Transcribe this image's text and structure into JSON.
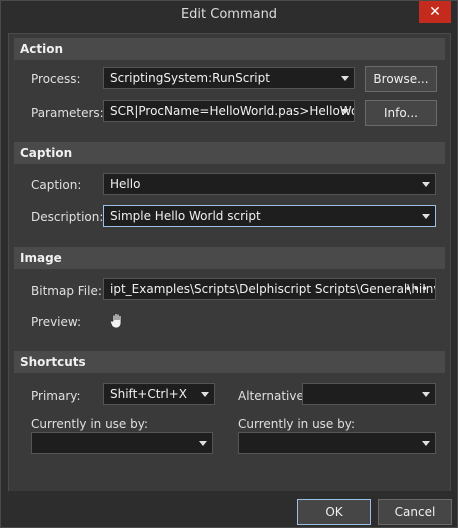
{
  "window": {
    "title": "Edit Command",
    "close": "✕"
  },
  "action": {
    "header": "Action",
    "process_label": "Process:",
    "process_value": "ScriptingSystem:RunScript",
    "browse": "Browse...",
    "parameters_label": "Parameters:",
    "parameters_value": "SCR|ProcName=HelloWorld.pas>HelloWorld",
    "info": "Info..."
  },
  "caption": {
    "header": "Caption",
    "caption_label": "Caption:",
    "caption_value": "Hello",
    "description_label": "Description:",
    "description_value": "Simple Hello World script"
  },
  "image": {
    "header": "Image",
    "bitmap_label": "Bitmap File:",
    "bitmap_value": "ipt_Examples\\Scripts\\Delphiscript Scripts\\General\\hiInv.png",
    "bitmap_more": "•••",
    "preview_label": "Preview:"
  },
  "shortcuts": {
    "header": "Shortcuts",
    "primary_label": "Primary:",
    "primary_value": "Shift+Ctrl+X",
    "alternative_label": "Alternative:",
    "alternative_value": "",
    "in_use_label_left": "Currently in use by:",
    "in_use_label_right": "Currently in use by:",
    "in_use_value_left": "",
    "in_use_value_right": ""
  },
  "footer": {
    "ok": "OK",
    "cancel": "Cancel"
  }
}
